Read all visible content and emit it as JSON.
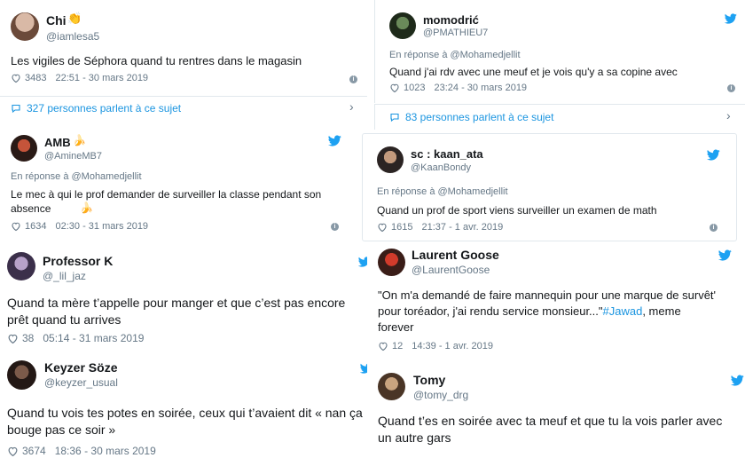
{
  "colors": {
    "link": "#1b95e0",
    "muted": "#657786",
    "text": "#14171a",
    "border": "#e1e8ed"
  },
  "tweets": [
    {
      "name": "Chi",
      "handle": "@iamlesa5",
      "reply": "",
      "text": "Les vigiles de Séphora quand  tu rentres dans le magasin",
      "likes": "3483",
      "time": "22:51 - 30 mars 2019"
    },
    {
      "name": "momodrić",
      "handle": "@PMATHIEU7",
      "reply": "En réponse à @Mohamedjellit",
      "text": "Quand j'ai rdv avec une meuf et je vois qu'y a sa copine avec",
      "likes": "1023",
      "time": "23:24 - 30 mars 2019"
    },
    {
      "name": "AMB",
      "handle": "@AmineMB7",
      "reply": "En réponse à @Mohamedjellit",
      "text": "Le mec à qui le prof demander de surveiller la classe pendant son absence",
      "likes": "1634",
      "time": "02:30 - 31 mars 2019"
    },
    {
      "name": "sc : kaan_ata",
      "handle": "@KaanBondy",
      "reply": "En réponse à @Mohamedjellit",
      "text": "Quand un prof de sport viens surveiller un examen de math",
      "likes": "1615",
      "time": "21:37 - 1 avr. 2019"
    },
    {
      "name": "Professor K",
      "handle": "@_lil_jaz",
      "reply": "",
      "text": "Quand ta mère t’appelle pour manger et que c’est pas encore prêt quand tu arrives",
      "likes": "38",
      "time": "05:14 - 31 mars 2019"
    },
    {
      "name": "Laurent Goose",
      "handle": "@LaurentGoose",
      "reply": "",
      "text": "\"On m'a demandé de faire mannequin pour une marque de survêt' pour toréador, j'ai rendu service monsieur...\"",
      "hashtag": "#Jawad",
      "text_after": ", meme forever",
      "likes": "12",
      "time": "14:39 - 1 avr. 2019"
    },
    {
      "name": "Keyzer Söze",
      "handle": "@keyzer_usual",
      "reply": "",
      "text": "Quand tu vois tes potes en soirée, ceux qui t’avaient dit « nan ça bouge pas ce soir »",
      "likes": "3674",
      "time": "18:36 - 30 mars 2019"
    },
    {
      "name": "Tomy",
      "handle": "@tomy_drg",
      "reply": "",
      "text": "Quand t’es en soirée avec ta meuf et que tu la vois parler avec un autre gars",
      "likes": "",
      "time": ""
    }
  ],
  "conversations": [
    {
      "label": "327 personnes parlent à ce sujet"
    },
    {
      "label": "83 personnes parlent à ce sujet"
    }
  ],
  "icons": {
    "like": "heart-icon",
    "info": "info-icon",
    "bird": "twitter-bird-icon",
    "talk": "speech-bubble-icon",
    "chevron": "chevron-right-icon"
  }
}
